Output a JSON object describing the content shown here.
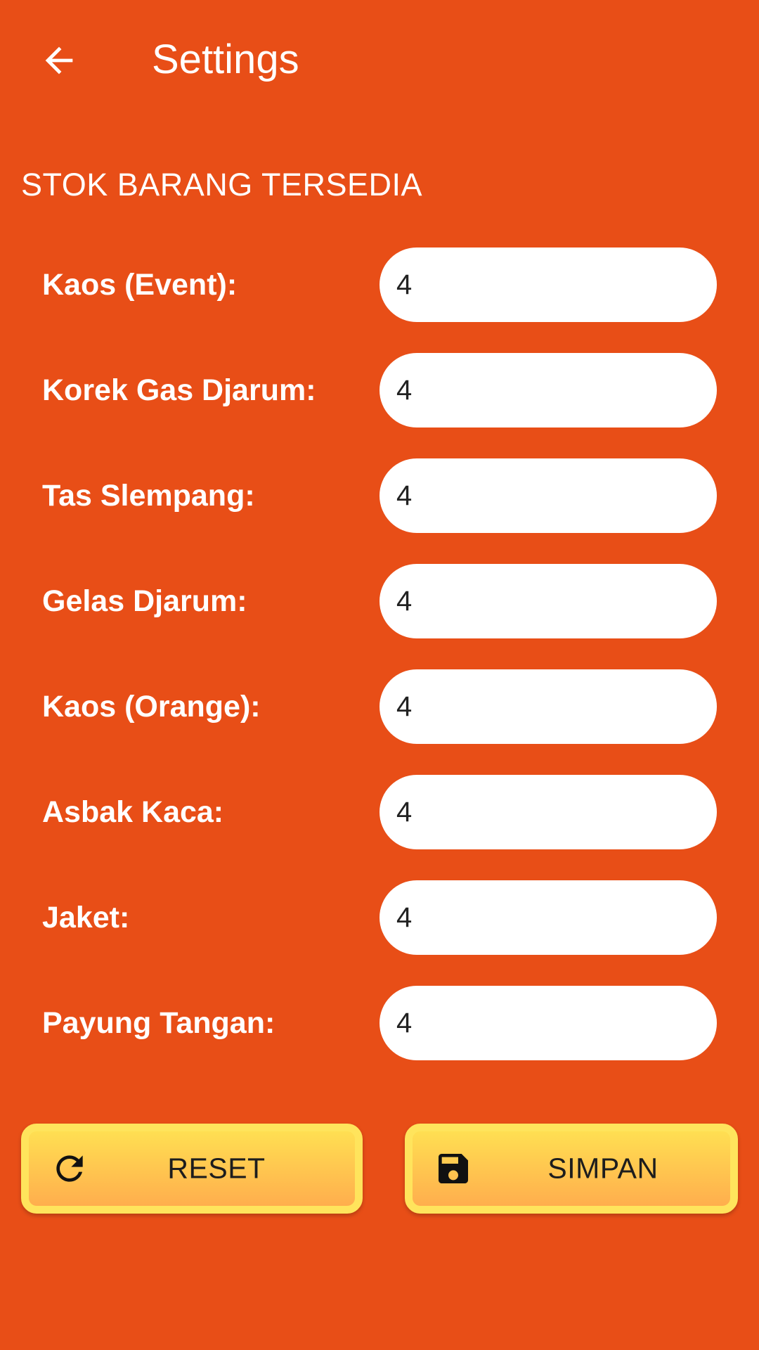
{
  "header": {
    "title": "Settings",
    "back_icon": "arrow-left-icon"
  },
  "section": {
    "title": "STOK BARANG TERSEDIA"
  },
  "items": [
    {
      "label": "Kaos (Event):",
      "value": "4"
    },
    {
      "label": "Korek Gas Djarum:",
      "value": "4"
    },
    {
      "label": "Tas Slempang:",
      "value": "4"
    },
    {
      "label": "Gelas Djarum:",
      "value": "4"
    },
    {
      "label": "Kaos (Orange):",
      "value": "4"
    },
    {
      "label": "Asbak Kaca:",
      "value": "4"
    },
    {
      "label": "Jaket:",
      "value": "4"
    },
    {
      "label": "Payung Tangan:",
      "value": "4"
    }
  ],
  "buttons": {
    "reset_label": "RESET",
    "reset_icon": "refresh-icon",
    "save_label": "SIMPAN",
    "save_icon": "floppy-disk-icon"
  },
  "colors": {
    "background": "#E84E17",
    "button_border": "#FFE45C",
    "button_top": "#FFDF52",
    "button_bottom": "#FFAE4D",
    "text_light": "#FFFFFF"
  }
}
